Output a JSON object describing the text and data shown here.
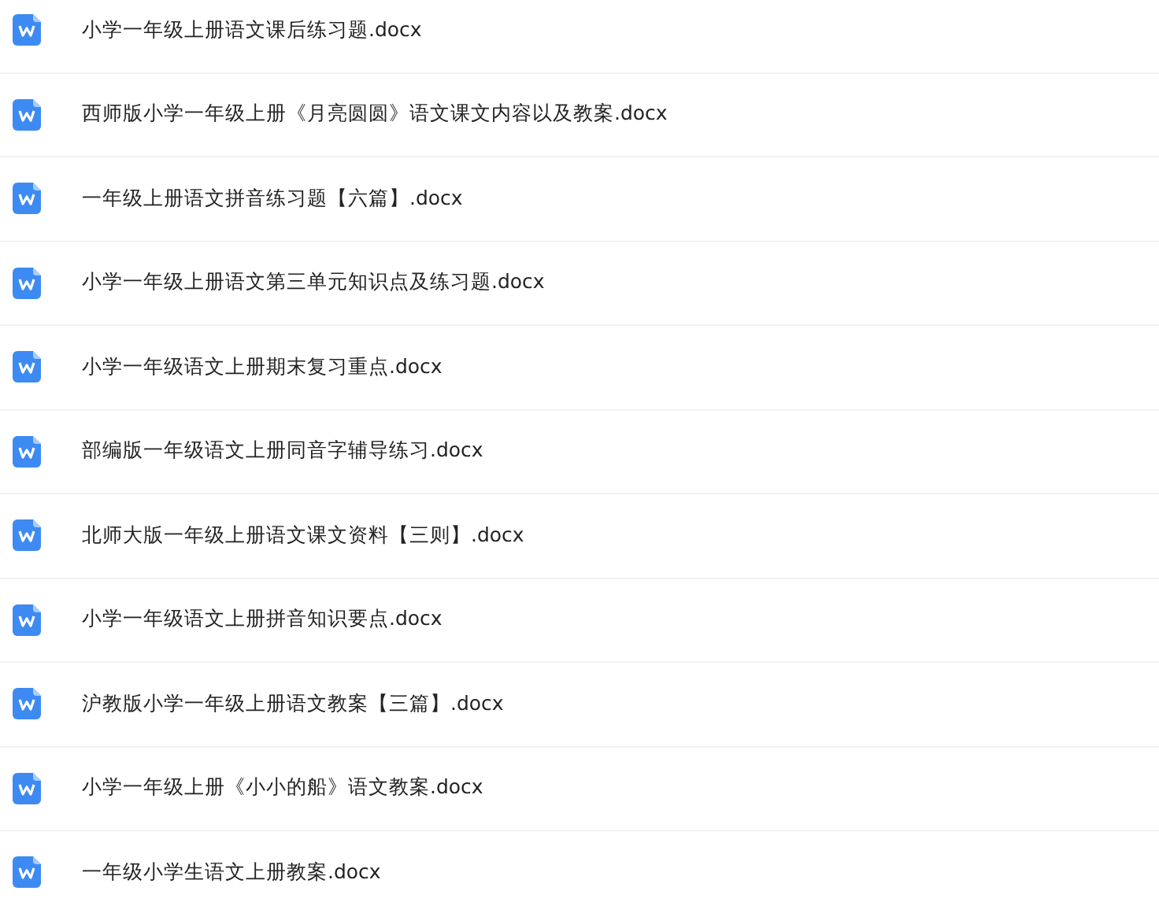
{
  "files": [
    {
      "name": "小学一年级上册语文课后练习题.docx"
    },
    {
      "name": "西师版小学一年级上册《月亮圆圆》语文课文内容以及教案.docx"
    },
    {
      "name": "一年级上册语文拼音练习题【六篇】.docx"
    },
    {
      "name": "小学一年级上册语文第三单元知识点及练习题.docx"
    },
    {
      "name": "小学一年级语文上册期末复习重点.docx"
    },
    {
      "name": "部编版一年级语文上册同音字辅导练习.docx"
    },
    {
      "name": "北师大版一年级上册语文课文资料【三则】.docx"
    },
    {
      "name": "小学一年级语文上册拼音知识要点.docx"
    },
    {
      "name": "沪教版小学一年级上册语文教案【三篇】.docx"
    },
    {
      "name": "小学一年级上册《小小的船》语文教案.docx"
    },
    {
      "name": "一年级小学生语文上册教案.docx"
    }
  ]
}
